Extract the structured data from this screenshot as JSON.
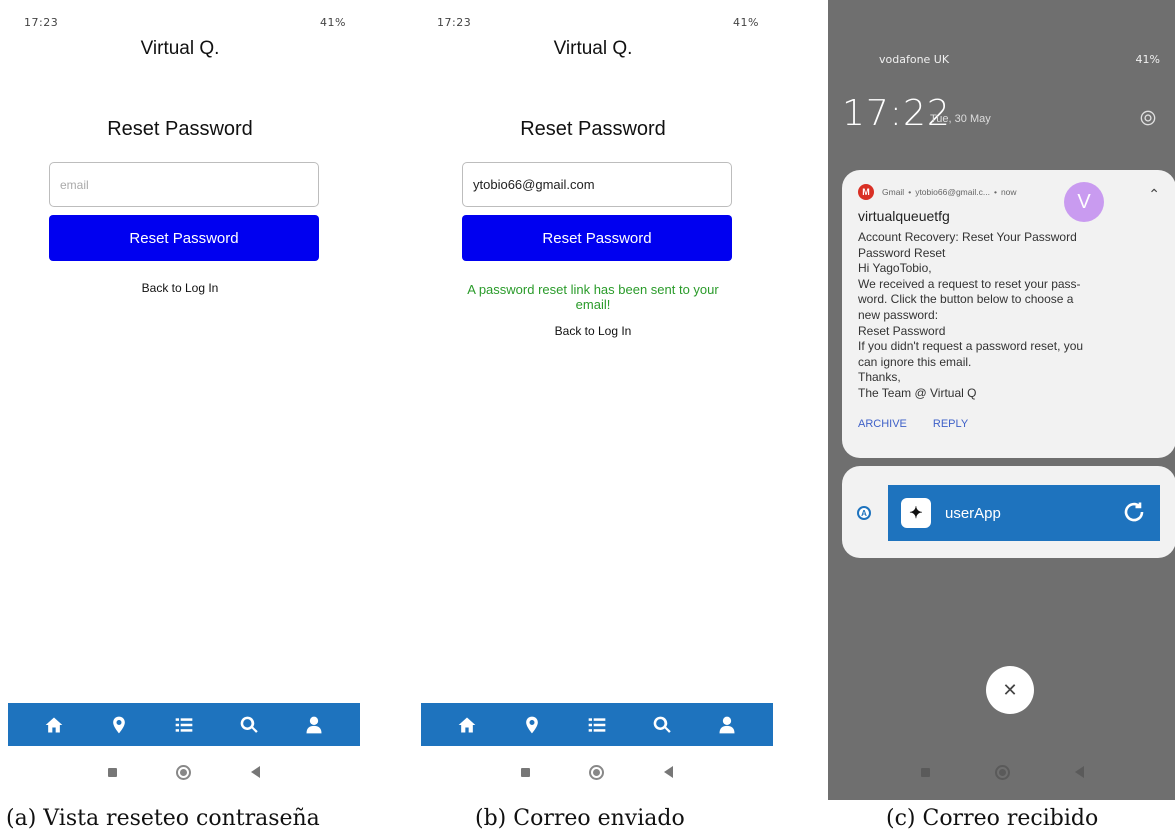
{
  "panel_a": {
    "status_time": "17:23",
    "status_right": "41%",
    "app_title": "Virtual Q.",
    "heading": "Reset Password",
    "email_placeholder": "email",
    "button_label": "Reset Password",
    "back_label": "Back to Log In",
    "caption": "(a) Vista reseteo contraseña"
  },
  "panel_b": {
    "status_time": "17:23",
    "status_right": "41%",
    "app_title": "Virtual Q.",
    "heading": "Reset Password",
    "email_value": "ytobio66@gmail.com",
    "button_label": "Reset Password",
    "success_message": "A password reset link has been sent to your email!",
    "back_label": "Back to Log In",
    "caption": "(b) Correo enviado"
  },
  "panel_c": {
    "carrier": "vodafone UK",
    "status_right": "41%",
    "time": "17:22",
    "date": "Tue, 30 May",
    "notification": {
      "app": "Gmail",
      "account": "ytobio66@gmail.c...",
      "when": "now",
      "avatar_letter": "V",
      "sender": "virtualqueuetfg",
      "lines": [
        "Account Recovery: Reset Your Password",
        "Password Reset",
        "Hi YagoTobio,",
        "We received a request to reset your pass-",
        "word. Click the button below to choose a",
        "new password:",
        "Reset Password",
        "If you didn't request a password reset, you",
        "can ignore this email.",
        "Thanks,",
        "The Team @ Virtual Q"
      ],
      "action_archive": "ARCHIVE",
      "action_reply": "REPLY"
    },
    "app_name": "userApp",
    "caption": "(c) Correo recibido"
  },
  "icons": {
    "nav": [
      "home-icon",
      "map-marker-icon",
      "list-icon",
      "search-icon",
      "user-icon"
    ],
    "nav_bar_color": "#1e73be",
    "button_color": "#0000f0",
    "success_color": "#2a9b2a"
  }
}
